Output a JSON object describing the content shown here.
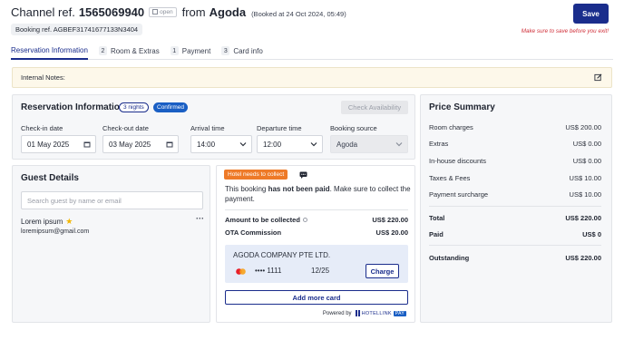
{
  "header": {
    "channel_label": "Channel ref.",
    "channel_number": "1565069940",
    "open_label": "open",
    "from_label": "from",
    "source": "Agoda",
    "booked_at": "(Booked at 24 Oct 2024, 05:49)",
    "booking_ref": "Booking ref. AGBEF31741677133N3404",
    "save_label": "Save",
    "save_hint": "Make sure to save before you exit!"
  },
  "tabs": [
    {
      "num": "",
      "label": "Reservation Information",
      "active": true
    },
    {
      "num": "2",
      "label": "Room & Extras"
    },
    {
      "num": "1",
      "label": "Payment"
    },
    {
      "num": "3",
      "label": "Card info"
    }
  ],
  "notes": {
    "label": "Internal Notes:"
  },
  "reservation": {
    "title": "Reservation Information",
    "nights": "3 nights",
    "status": "Confirmed",
    "check_availability": "Check Availability",
    "checkin_label": "Check-in date",
    "checkin_value": "01 May 2025",
    "checkout_label": "Check-out date",
    "checkout_value": "03 May 2025",
    "arrival_label": "Arrival time",
    "arrival_value": "14:00",
    "departure_label": "Departure time",
    "departure_value": "12:00",
    "source_label": "Booking source",
    "source_value": "Agoda"
  },
  "guest": {
    "title": "Guest Details",
    "search_placeholder": "Search guest by name or email",
    "name": "Lorem ipsum",
    "more": "···",
    "email": "loremipsum@gmail.com"
  },
  "payment": {
    "badge": "Hotel needs to collect",
    "msg_pre": "This booking ",
    "msg_bold": "has not been paid",
    "msg_post": ". Make sure to collect the payment.",
    "amount_label": "Amount to be collected",
    "amount_value": "US$ 220.00",
    "commission_label": "OTA Commission",
    "commission_value": "US$ 20.00",
    "card_company": "AGODA COMPANY PTE LTD.",
    "card_number": "•••• 1111",
    "card_expiry": "12/25",
    "charge_label": "Charge",
    "add_card_label": "Add more card",
    "powered_by": "Powered by",
    "logo_text": "HOTELLINK",
    "logo_pay": "PAY"
  },
  "price": {
    "title": "Price Summary",
    "rows": [
      {
        "label": "Room charges",
        "value": "US$ 200.00"
      },
      {
        "label": "Extras",
        "value": "US$ 0.00"
      },
      {
        "label": "In-house discounts",
        "value": "US$ 0.00"
      },
      {
        "label": "Taxes & Fees",
        "value": "US$ 10.00"
      },
      {
        "label": "Payment surcharge",
        "value": "US$ 10.00"
      }
    ],
    "total_label": "Total",
    "total_value": "US$ 220.00",
    "paid_label": "Paid",
    "paid_value": "US$ 0",
    "outstanding_label": "Outstanding",
    "outstanding_value": "US$ 220.00"
  },
  "colors": {
    "primary": "#1a2d8c",
    "confirmed": "#1a5fc4",
    "warning": "#ee7a28",
    "error_text": "#d0303a",
    "notes_bg": "#fdf8ea"
  }
}
